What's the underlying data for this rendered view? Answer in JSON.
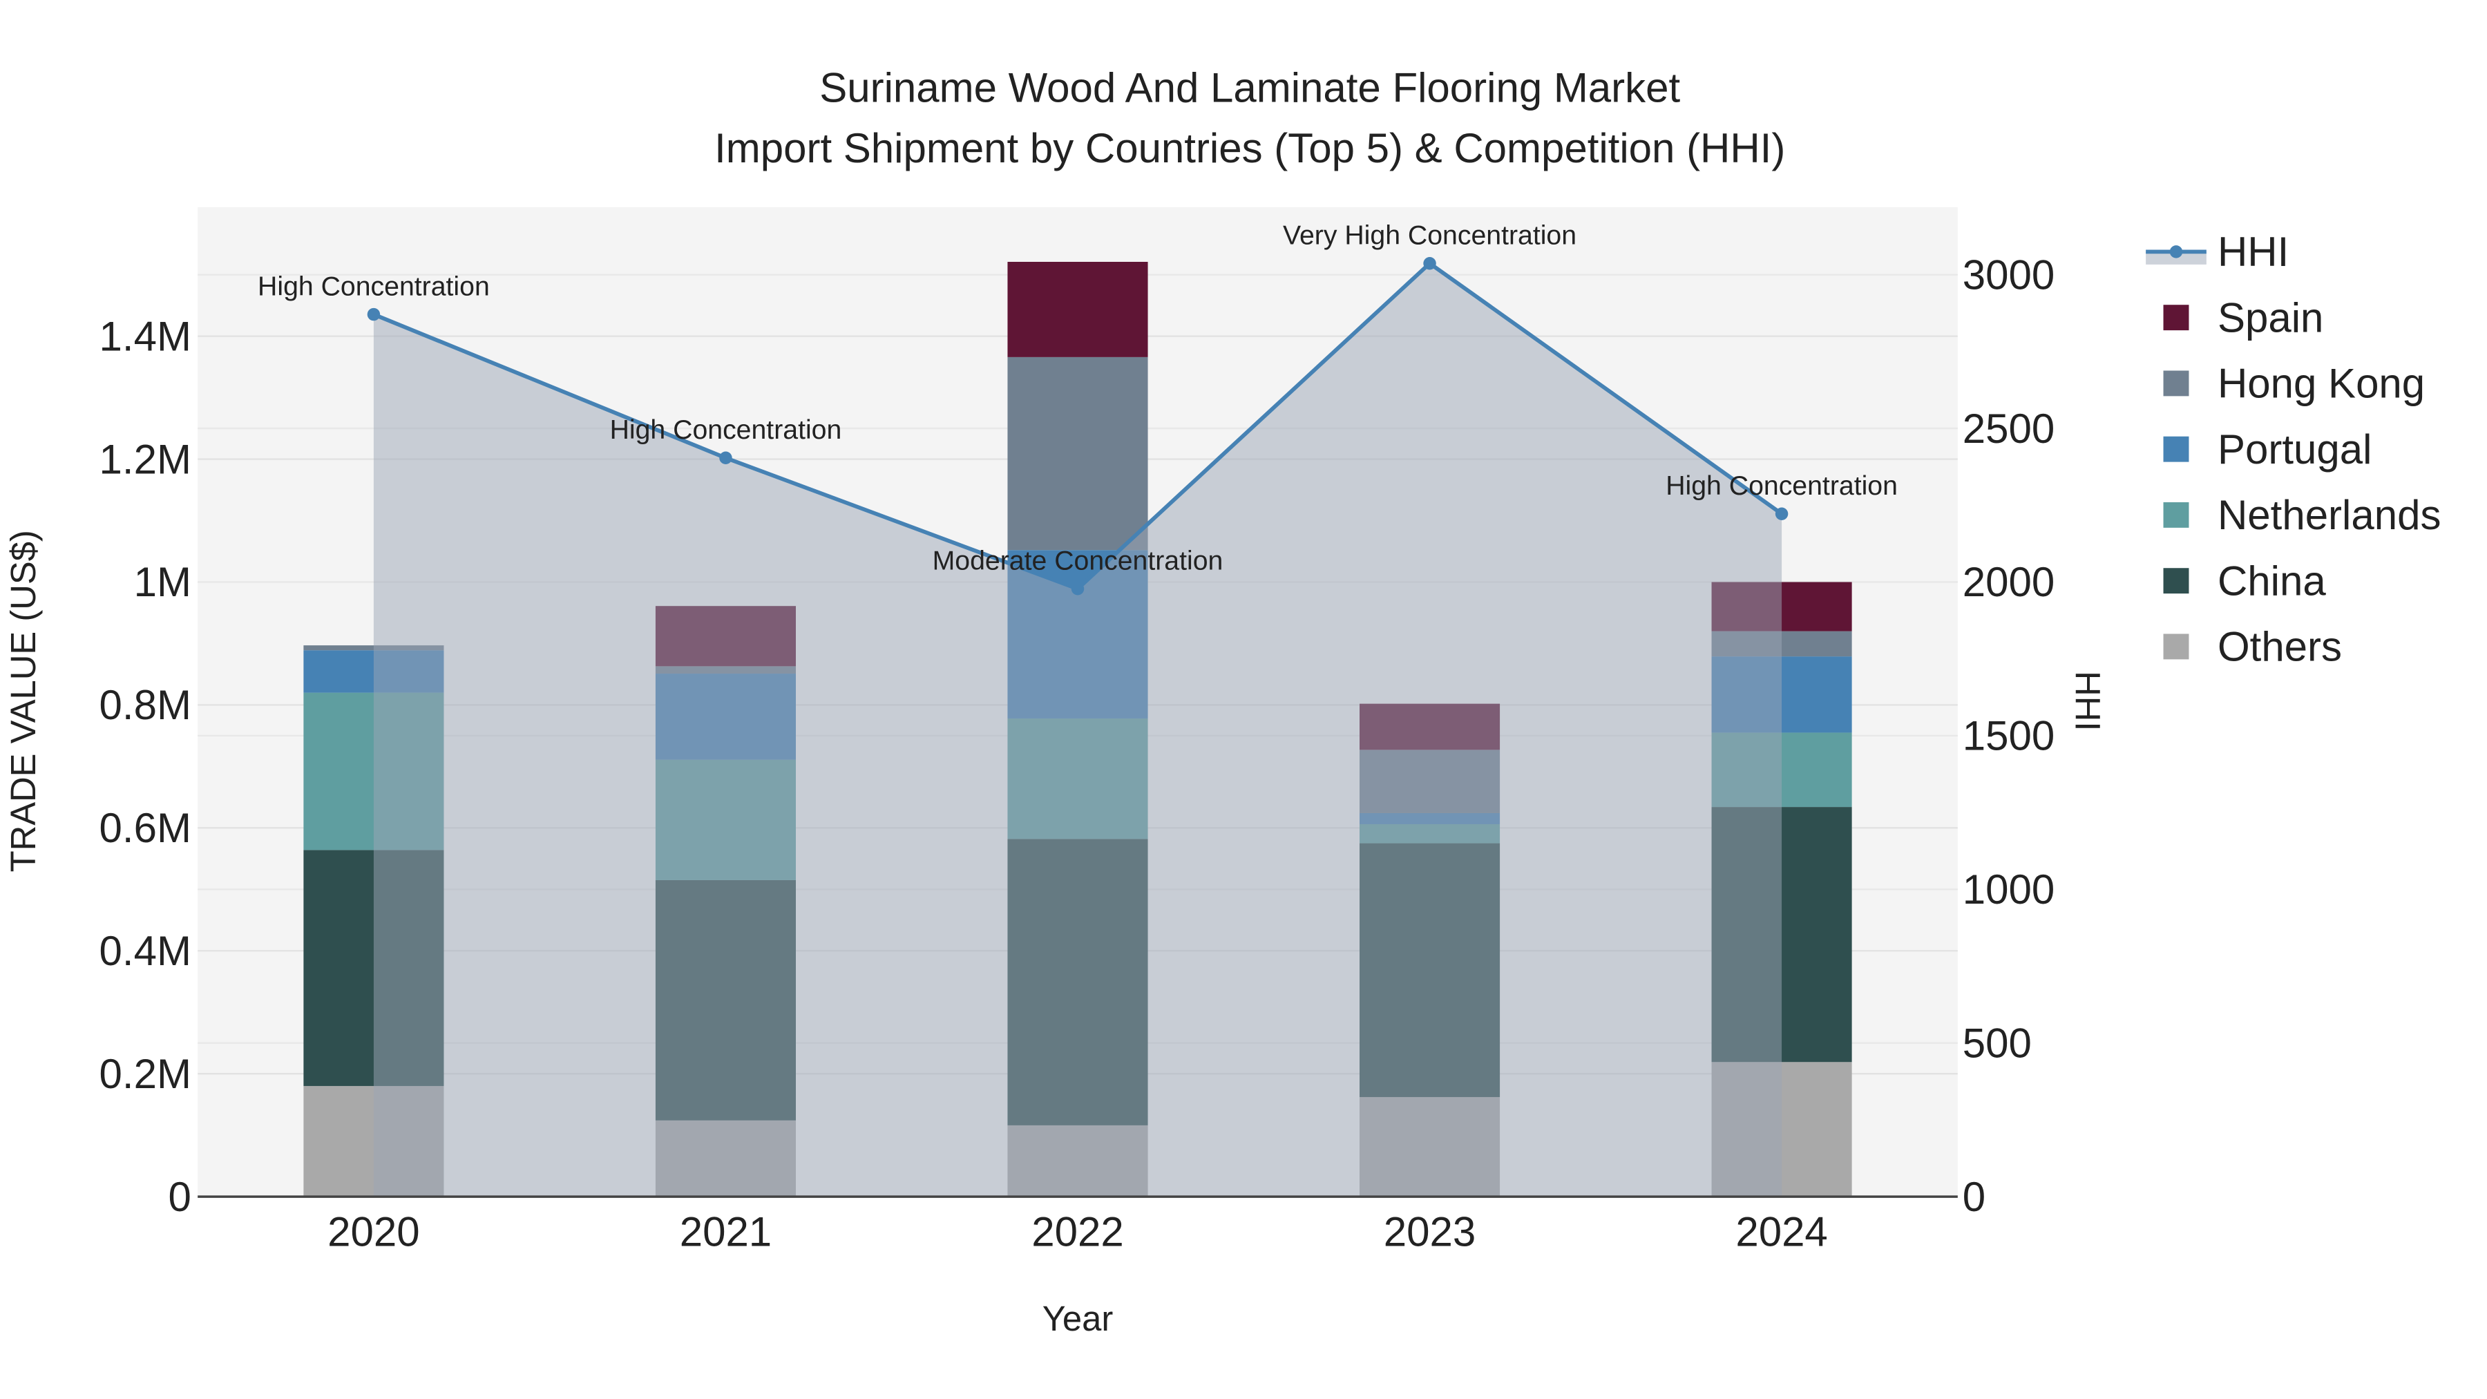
{
  "chart_data": {
    "type": "bar",
    "title_line1": "Suriname Wood And Laminate Flooring Market",
    "title_line2": "Import Shipment by Countries (Top 5) & Competition (HHI)",
    "xlabel": "Year",
    "ylabel": "TRADE VALUE (US$)",
    "y2label": "HHI",
    "categories": [
      "2020",
      "2021",
      "2022",
      "2023",
      "2024"
    ],
    "ylim": [
      0,
      1610000
    ],
    "y2lim": [
      0,
      3220
    ],
    "yticks": [
      {
        "v": 0,
        "label": "0"
      },
      {
        "v": 200000,
        "label": "0.2M"
      },
      {
        "v": 400000,
        "label": "0.4M"
      },
      {
        "v": 600000,
        "label": "0.6M"
      },
      {
        "v": 800000,
        "label": "0.8M"
      },
      {
        "v": 1000000,
        "label": "1M"
      },
      {
        "v": 1200000,
        "label": "1.2M"
      },
      {
        "v": 1400000,
        "label": "1.4M"
      }
    ],
    "y2ticks": [
      {
        "v": 0,
        "label": "0"
      },
      {
        "v": 500,
        "label": "500"
      },
      {
        "v": 1000,
        "label": "1000"
      },
      {
        "v": 1500,
        "label": "1500"
      },
      {
        "v": 2000,
        "label": "2000"
      },
      {
        "v": 2500,
        "label": "2500"
      },
      {
        "v": 3000,
        "label": "3000"
      }
    ],
    "series": [
      {
        "name": "Others",
        "color": "#a9a9a9",
        "values": [
          180000,
          124000,
          116000,
          162000,
          219000
        ]
      },
      {
        "name": "China",
        "color": "#2f4f4f",
        "values": [
          384000,
          391000,
          466000,
          413000,
          415000
        ]
      },
      {
        "name": "Netherlands",
        "color": "#5f9ea0",
        "values": [
          256000,
          196000,
          196000,
          31000,
          121000
        ]
      },
      {
        "name": "Portugal",
        "color": "#4682b4",
        "values": [
          69000,
          140000,
          274000,
          18000,
          124000
        ]
      },
      {
        "name": "Hong Kong",
        "color": "#708090",
        "values": [
          8000,
          12000,
          314000,
          103000,
          41000
        ]
      },
      {
        "name": "Spain",
        "color": "#5f1535",
        "values": [
          0,
          98000,
          155000,
          75000,
          80000
        ]
      }
    ],
    "hhi": {
      "name": "HHI",
      "color": "#4682b4",
      "values": [
        2871,
        2404,
        1978,
        3037,
        2222
      ],
      "annotations": [
        "High Concentration",
        "High Concentration",
        "Moderate Concentration",
        "Very High Concentration",
        "High Concentration"
      ]
    },
    "legend_order": [
      "HHI",
      "Spain",
      "Hong Kong",
      "Portugal",
      "Netherlands",
      "China",
      "Others"
    ],
    "legend_position": "right",
    "grid": true
  }
}
